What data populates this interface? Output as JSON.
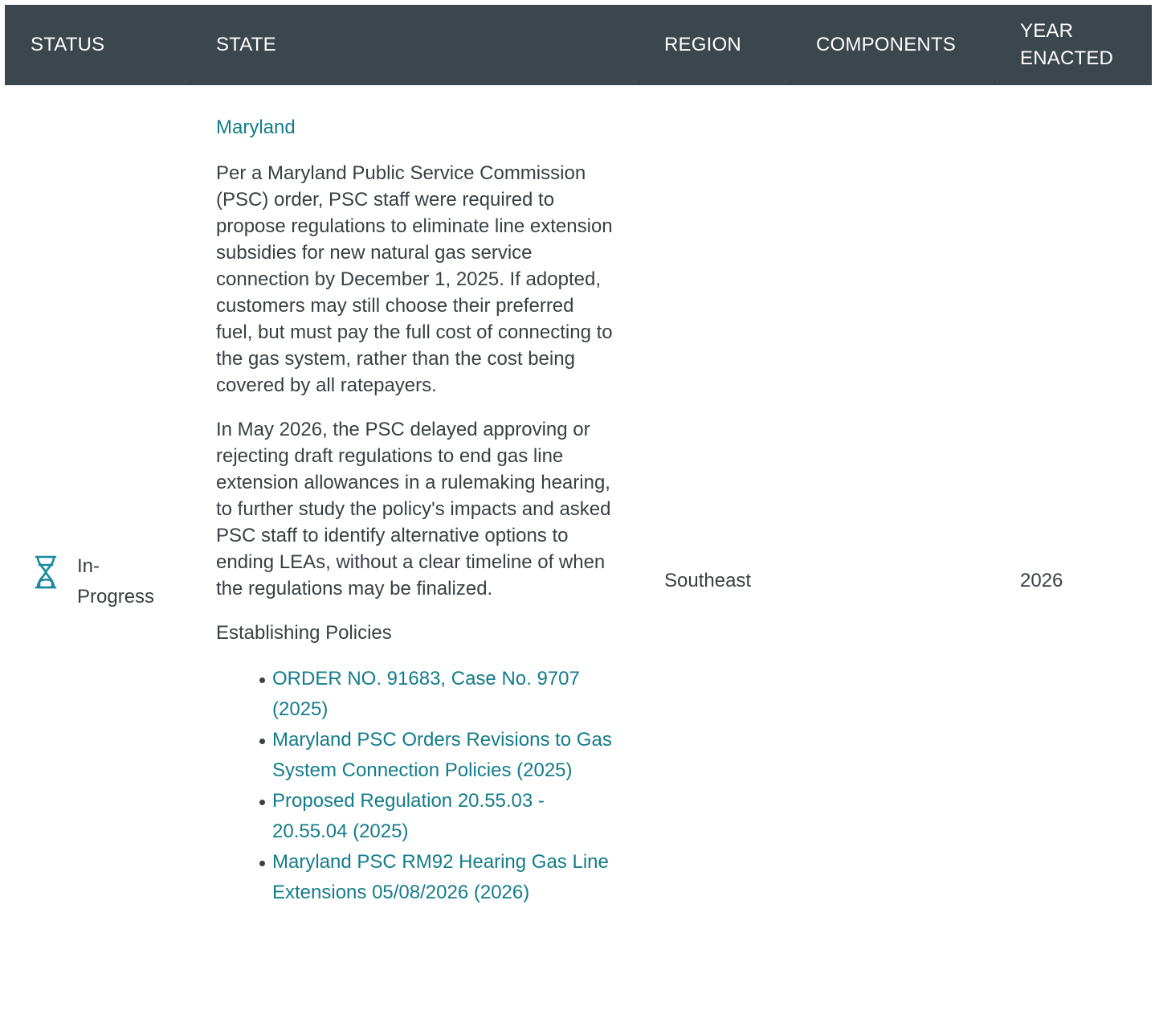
{
  "table": {
    "headers": {
      "status": "STATUS",
      "state": "STATE",
      "region": "REGION",
      "components": "COMPONENTS",
      "year_line1": "YEAR",
      "year_line2": "ENACTED"
    },
    "row": {
      "status": {
        "icon": "hourglass-icon",
        "line1": "In-",
        "line2": "Progress",
        "icon_color": "#1a8a9b"
      },
      "state": {
        "name": "Maryland",
        "paragraph1": "Per a Maryland Public Service Commission (PSC) order, PSC staff were required to propose regulations to eliminate line extension subsidies for new natural gas service connection by December 1, 2025. If adopted, customers may still choose their preferred fuel, but must pay the full cost of connecting to the gas system, rather than the cost being covered by all ratepayers.",
        "paragraph2": "In May 2026, the PSC delayed approving or rejecting draft regulations to end gas line extension allowances in a rulemaking hearing, to further study the policy's impacts and asked PSC staff to identify alternative options to ending LEAs, without a clear timeline of when the regulations may be finalized.",
        "policies_heading": "Establishing Policies",
        "policies": [
          {
            "label": "ORDER NO. 91683, Case No. 9707 (2025)"
          },
          {
            "label": "Maryland PSC Orders Revisions to Gas System Connection Policies (2025)"
          },
          {
            "label": "Proposed Regulation 20.55.03 - 20.55.04 (2025)"
          },
          {
            "label": "Maryland PSC RM92 Hearing Gas Line Extensions 05/08/2026 (2026)"
          }
        ]
      },
      "region": "Southeast",
      "components": "",
      "year": "2026"
    }
  },
  "colors": {
    "header_bg": "#3b464d",
    "link": "#147c8a",
    "text": "#3a3f43"
  }
}
